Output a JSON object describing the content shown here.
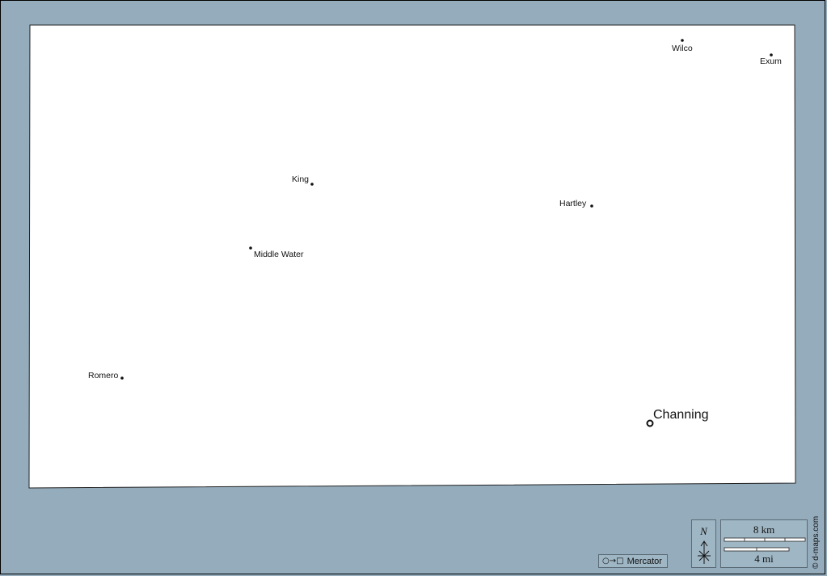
{
  "map": {
    "background_color": "#94acbc",
    "land_color": "#ffffff",
    "places": [
      {
        "name": "Wilco",
        "type": "town"
      },
      {
        "name": "Exum",
        "type": "town"
      },
      {
        "name": "King",
        "type": "town"
      },
      {
        "name": "Hartley",
        "type": "town"
      },
      {
        "name": "Middle Water",
        "type": "town"
      },
      {
        "name": "Romero",
        "type": "town"
      },
      {
        "name": "Channing",
        "type": "county-seat"
      }
    ]
  },
  "legend": {
    "projection_symbol": "○→□",
    "projection_label": "Mercator",
    "north_label": "N",
    "scale_km_label": "8 km",
    "scale_mi_label": "4 mi",
    "credit": "© d-maps.com"
  }
}
